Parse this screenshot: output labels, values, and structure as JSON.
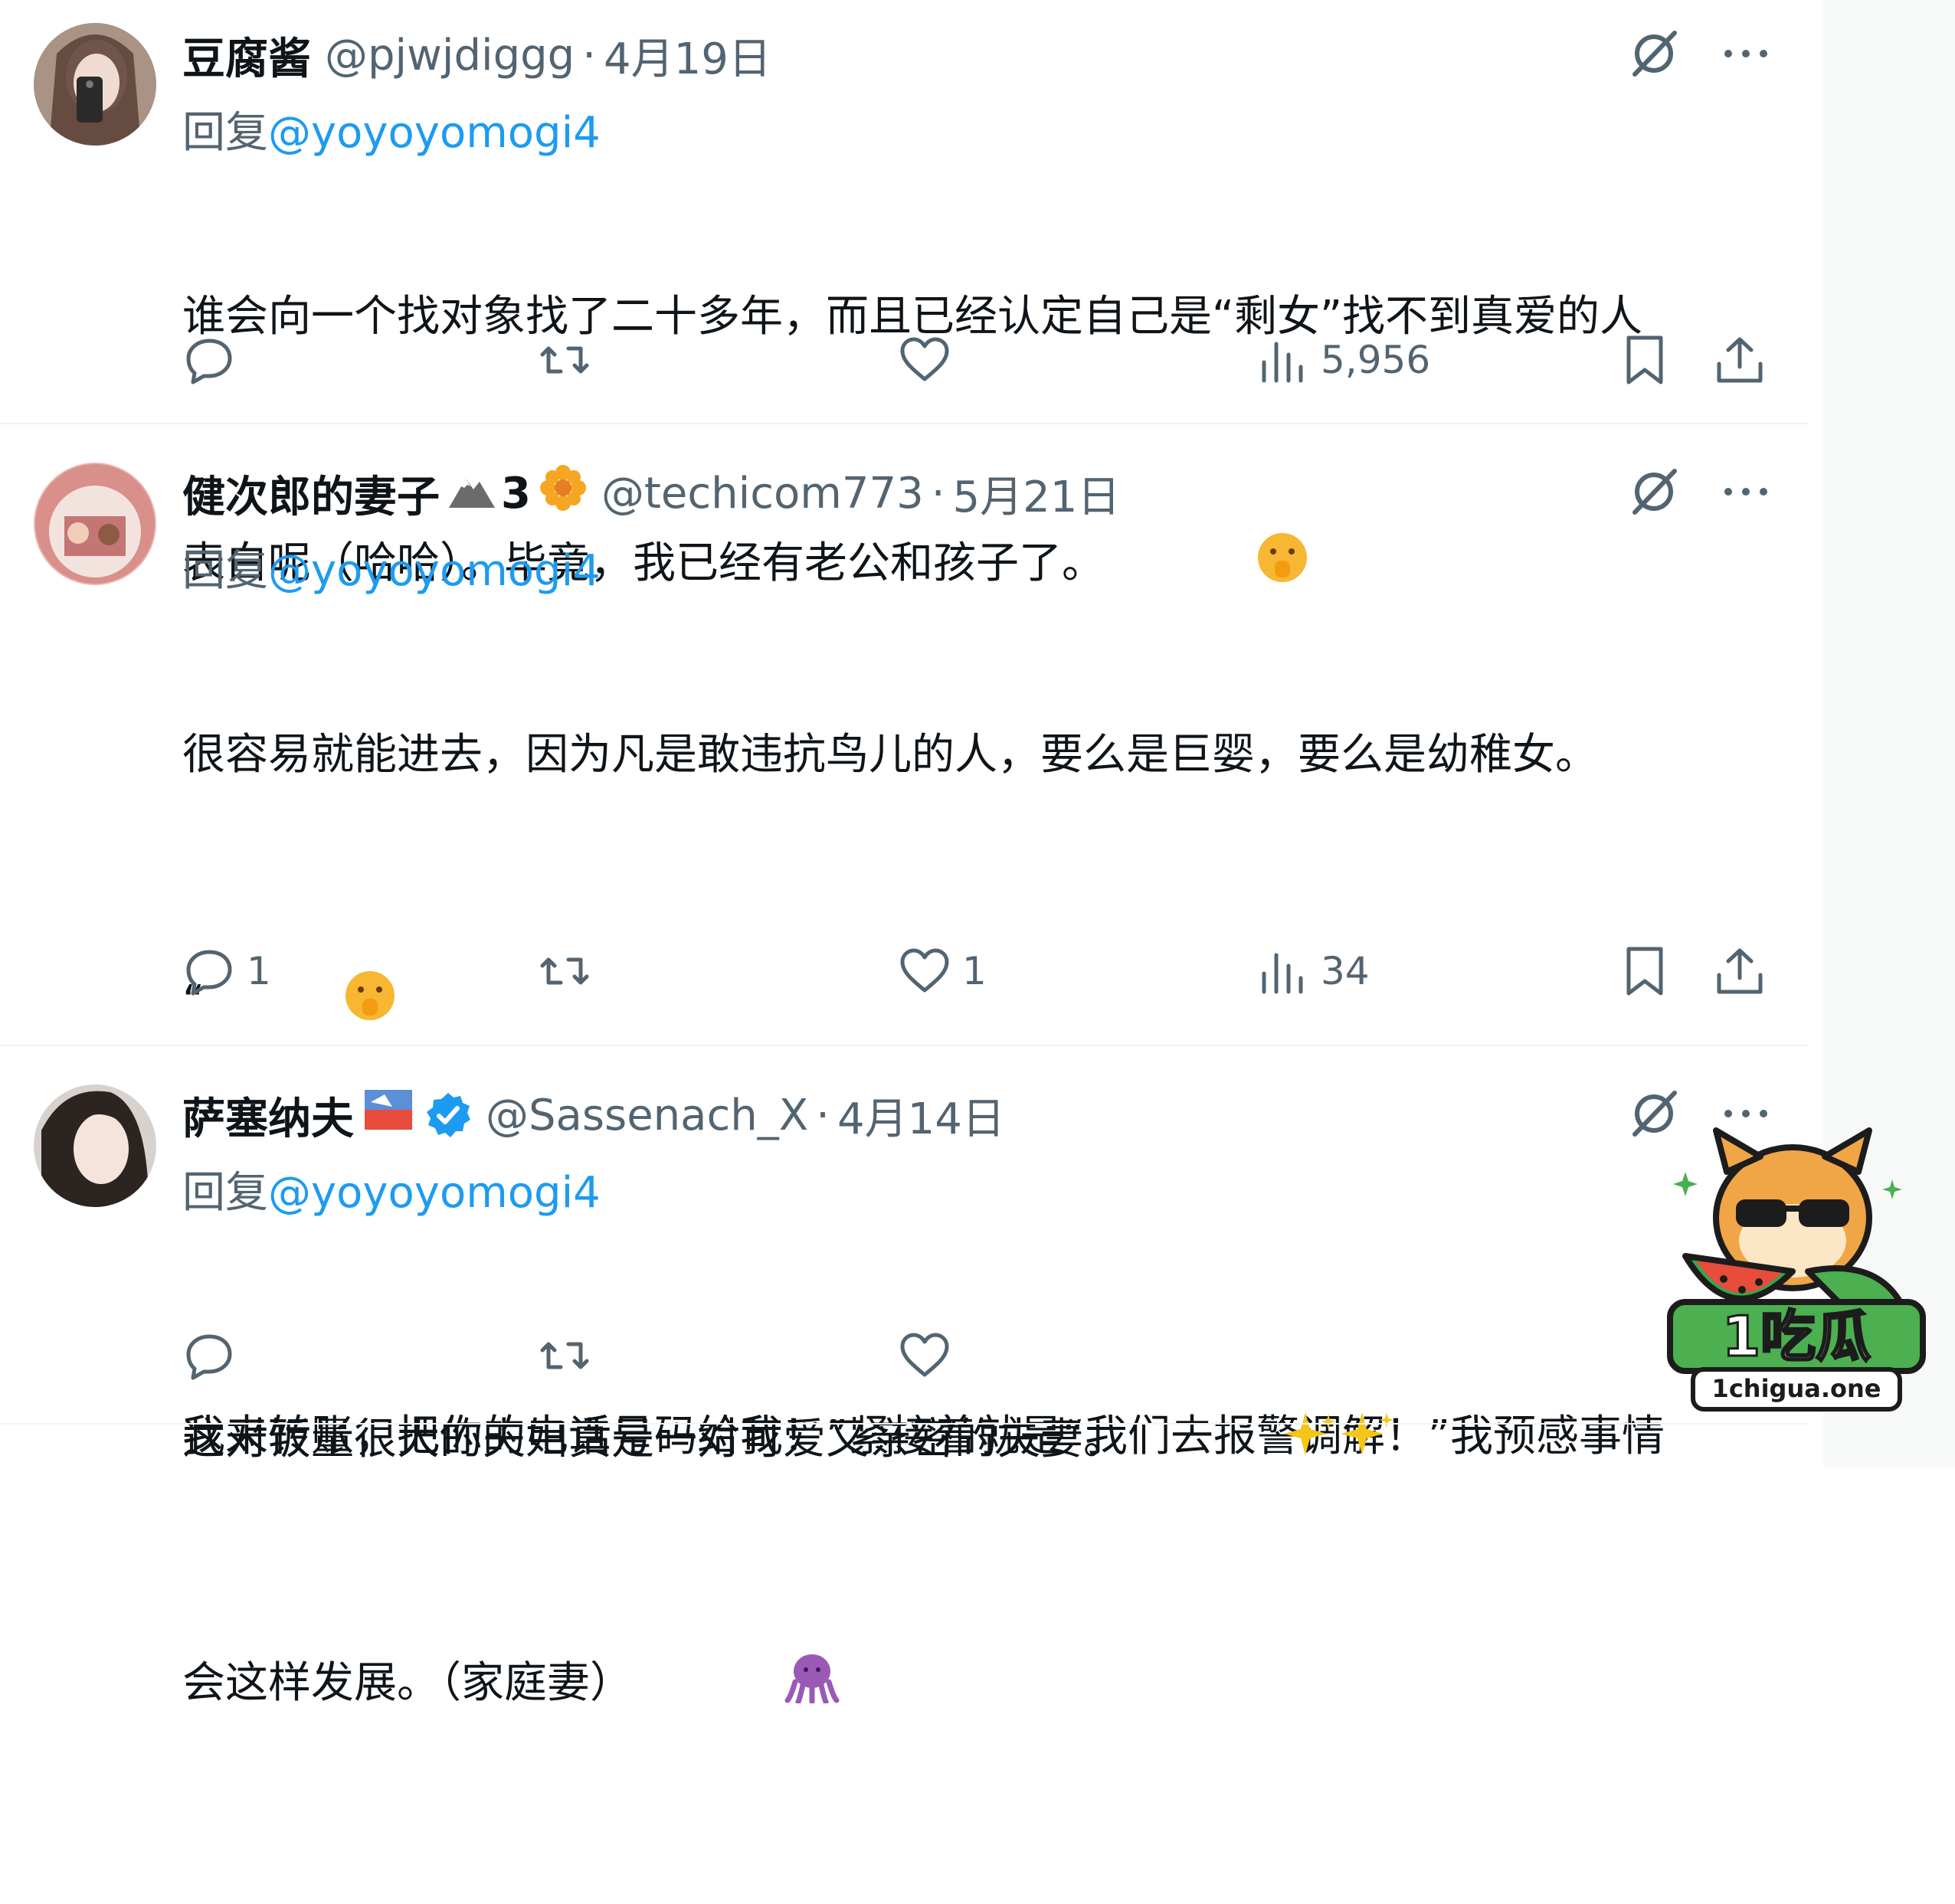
{
  "tweets": [
    {
      "display_name": "豆腐酱",
      "handle": "@pjwjdiggg",
      "date": "4月19日",
      "reply_prefix": "回复",
      "reply_to": "@yoyoyomogi4",
      "text_lines": [
        "谁会向一个找对象找了二十多年，而且已经认定自己是“剩女”找不到真爱的人",
        "表白呢（哈哈）。毕竟，我已经有老公和孩子了。"
      ],
      "actions": {
        "replies": "",
        "retweets": "",
        "likes": "",
        "views": "5,956"
      }
    },
    {
      "display_name": "健次郎的妻子",
      "name_suffix": "3",
      "handle": "@techicom773",
      "date": "5月21日",
      "reply_prefix": "回复",
      "reply_to": "@yoyoyomogi4",
      "text_lines": [
        "很容易就能进去，因为凡是敢违抗鸟儿的人，要么是巨婴，要么是幼稚女。",
        "“",
        "",
        "我来转账，把你的电话号码给我！”紧接着就是“我们去报警调解！”我预感事情",
        "会这样发展。（家庭妻）"
      ],
      "actions": {
        "replies": "1",
        "retweets": "",
        "likes": "1",
        "views": "34"
      }
    },
    {
      "display_name": "萨塞纳夫",
      "handle": "@Sassenach_X",
      "date": "4月14日",
      "reply_prefix": "回复",
      "reply_to": "@yoyoyomogi4",
      "text_lines": [
        "这对饭量很大的夫妇真是一对可爱又亲密的夫妻。"
      ],
      "actions": {
        "replies": "",
        "retweets": "",
        "likes": ""
      }
    }
  ],
  "separator": "·",
  "watermark": {
    "brand": "1吃瓜",
    "url": "1chigua.one"
  },
  "icons": [
    "grok-icon",
    "more-icon",
    "reply-icon",
    "retweet-icon",
    "like-icon",
    "views-icon",
    "bookmark-icon",
    "share-icon"
  ],
  "colors": {
    "link": "#1d9bf0",
    "secondary": "#536471",
    "text": "#0f1419",
    "divider": "#eff3f4"
  }
}
